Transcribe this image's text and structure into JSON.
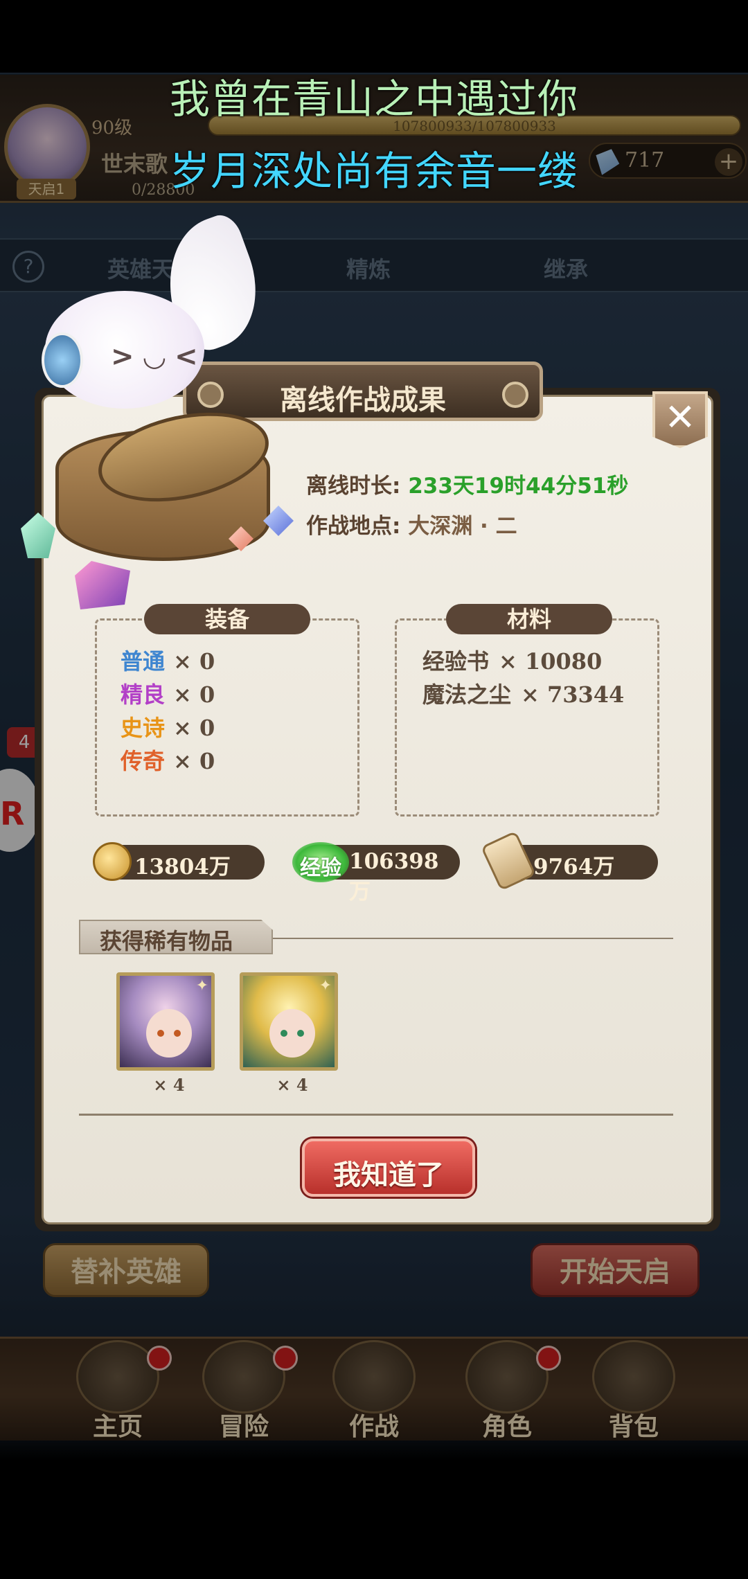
{
  "lyrics": {
    "line1": "我曾在青山之中遇过你",
    "line2": "岁月深处尚有余音一缕"
  },
  "player": {
    "level": "90级",
    "exp": "107800933/107800933",
    "name": "世末歌",
    "rebirth_badge": "天启1",
    "rebirth_progress": "0/28800",
    "gems": "717",
    "gem_plus": "+"
  },
  "tabs": {
    "help": "?",
    "hero": "英雄天启",
    "refine": "精炼",
    "inherit": "继承"
  },
  "side": {
    "badge": "4",
    "float_letter": "R"
  },
  "modal": {
    "title": "离线作战成果",
    "close": "✕",
    "mascot_face": "> ◡ <",
    "offline_label": "离线时长:",
    "offline_value": "233天19时44分51秒",
    "location_label": "作战地点:",
    "location_value": "大深渊 · 二",
    "equipment": {
      "header": "装备",
      "rows": [
        {
          "label": "普通",
          "qty": "× 0"
        },
        {
          "label": "精良",
          "qty": "× 0"
        },
        {
          "label": "史诗",
          "qty": "× 0"
        },
        {
          "label": "传奇",
          "qty": "× 0"
        }
      ]
    },
    "materials": {
      "header": "材料",
      "rows": [
        {
          "label": "经验书",
          "qty": "× 10080"
        },
        {
          "label": "魔法之尘",
          "qty": "× 73344"
        }
      ]
    },
    "resources": {
      "gold": "13804万",
      "exp_icon_label": "经验",
      "exp": "106398万",
      "scroll": "9764万"
    },
    "rare": {
      "title": "获得稀有物品",
      "items": [
        {
          "count": "× 4"
        },
        {
          "count": "× 4"
        }
      ]
    },
    "ok_button": "我知道了"
  },
  "bottom_buttons": {
    "substitute": "替补英雄",
    "start": "开始天启"
  },
  "nav": {
    "items": [
      {
        "label": "主页",
        "icon": "home-icon"
      },
      {
        "label": "冒险",
        "icon": "adventure-icon"
      },
      {
        "label": "作战",
        "icon": "battle-icon"
      },
      {
        "label": "角色",
        "icon": "character-icon"
      },
      {
        "label": "背包",
        "icon": "backpack-icon"
      }
    ]
  },
  "colors": {
    "accent_green": "#2aa02a",
    "equip_normal": "#3f86d0",
    "equip_fine": "#b23fc7",
    "equip_epic": "#e89417",
    "equip_legend": "#e0612a",
    "button_red": "#b8302b"
  }
}
